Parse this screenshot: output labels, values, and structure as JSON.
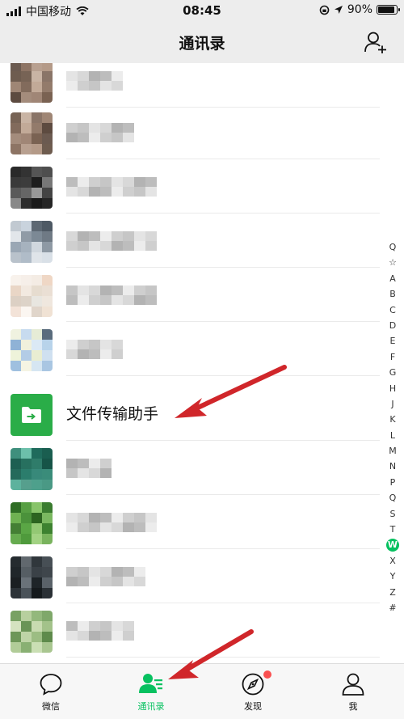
{
  "status_bar": {
    "carrier": "中国移动",
    "time": "08:45",
    "battery": "90%",
    "battery_level": 0.9
  },
  "nav": {
    "title": "通讯录",
    "add_icon": "add-friend-icon"
  },
  "section": {
    "letter": "W"
  },
  "file_transfer": {
    "name": "文件传输助手",
    "icon": "folder-arrow-icon"
  },
  "index_letters": [
    "Q",
    "☆",
    "A",
    "B",
    "C",
    "D",
    "E",
    "F",
    "G",
    "H",
    "J",
    "K",
    "L",
    "M",
    "N",
    "P",
    "Q",
    "S",
    "T",
    "W",
    "X",
    "Y",
    "Z",
    "#"
  ],
  "index_active": "W",
  "tabs": [
    {
      "label": "微信",
      "icon": "chat-bubble-icon",
      "active": false
    },
    {
      "label": "通讯录",
      "icon": "contacts-icon",
      "active": true
    },
    {
      "label": "发现",
      "icon": "compass-icon",
      "active": false,
      "badge": true
    },
    {
      "label": "我",
      "icon": "person-icon",
      "active": false
    }
  ],
  "colors": {
    "accent": "#07c160",
    "annotation_arrow": "#d0262a",
    "badge": "#fa5151",
    "file_icon_bg": "#2aad48"
  }
}
